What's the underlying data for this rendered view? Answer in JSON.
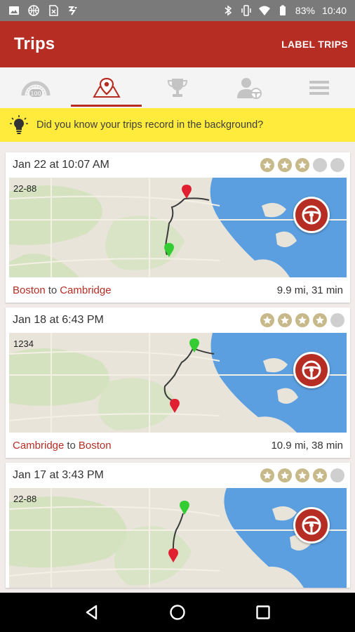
{
  "status_bar": {
    "battery": "83%",
    "time": "10:40",
    "left_icons": [
      "image-icon",
      "basketball-icon",
      "sim-x-icon",
      "sync-icon"
    ],
    "right_icons": [
      "bluetooth-icon",
      "vibrate-icon",
      "wifi-icon",
      "battery-icon"
    ]
  },
  "app_bar": {
    "title": "Trips",
    "action_label": "LABEL TRIPS",
    "color": "#b62d24"
  },
  "tabs": [
    {
      "name": "score-gauge-icon",
      "active": false
    },
    {
      "name": "map-pin-icon",
      "active": true
    },
    {
      "name": "trophy-icon",
      "active": false
    },
    {
      "name": "user-steering-icon",
      "active": false
    },
    {
      "name": "menu-icon",
      "active": false
    }
  ],
  "banner": {
    "text": "Did you know your trips record in the background?",
    "icon": "lightbulb-icon",
    "color": "#ffeb3b"
  },
  "trips": [
    {
      "datetime": "Jan 22 at 10:07 AM",
      "rating": 3,
      "max_rating": 5,
      "map_label": "22-88",
      "from": "Boston",
      "connector": "to",
      "to": "Cambridge",
      "distance_time": "9.9 mi, 31 min"
    },
    {
      "datetime": "Jan 18 at 6:43 PM",
      "rating": 4,
      "max_rating": 5,
      "map_label": "1234",
      "from": "Cambridge",
      "connector": "to",
      "to": "Boston",
      "distance_time": "10.9 mi, 38 min"
    },
    {
      "datetime": "Jan 17 at 3:43 PM",
      "rating": 4,
      "max_rating": 5,
      "map_label": "22-88",
      "from": "",
      "connector": "",
      "to": "",
      "distance_time": ""
    }
  ],
  "nav_bar": {
    "icons": [
      "back-icon",
      "home-icon",
      "recents-icon"
    ]
  }
}
